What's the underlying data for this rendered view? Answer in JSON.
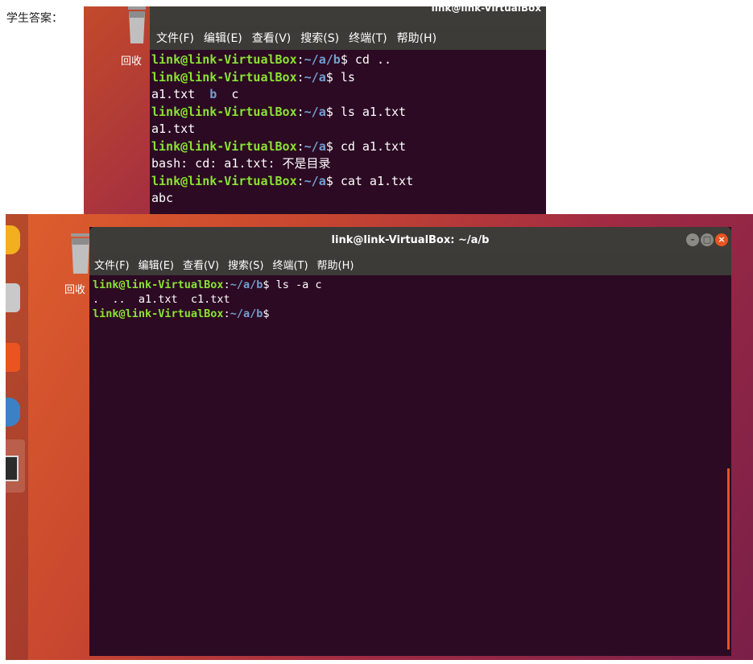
{
  "student_answer_label": "学生答案：",
  "shot1": {
    "title": "link@link-VirtualBox",
    "trash_caption": "回收",
    "menu": [
      "文件(F)",
      "编辑(E)",
      "查看(V)",
      "搜索(S)",
      "终端(T)",
      "帮助(H)"
    ],
    "lines": [
      {
        "user": "link@link-VirtualBox",
        "path": "~/a/b",
        "cmd": "cd .."
      },
      {
        "user": "link@link-VirtualBox",
        "path": "~/a",
        "cmd": "ls"
      },
      {
        "out_parts": [
          "a1.txt  ",
          "b",
          "  c"
        ]
      },
      {
        "user": "link@link-VirtualBox",
        "path": "~/a",
        "cmd": "ls a1.txt"
      },
      {
        "out": "a1.txt"
      },
      {
        "user": "link@link-VirtualBox",
        "path": "~/a",
        "cmd": "cd a1.txt"
      },
      {
        "out": "bash: cd: a1.txt: 不是目录"
      },
      {
        "user": "link@link-VirtualBox",
        "path": "~/a",
        "cmd": "cat a1.txt"
      },
      {
        "out": "abc"
      }
    ]
  },
  "shot2": {
    "title": "link@link-VirtualBox: ~/a/b",
    "trash_caption": "回收",
    "menu": [
      "文件(F)",
      "编辑(E)",
      "查看(V)",
      "搜索(S)",
      "终端(T)",
      "帮助(H)"
    ],
    "lines": [
      {
        "user": "link@link-VirtualBox",
        "path": "~/a/b",
        "cmd": "ls -a c"
      },
      {
        "out": ".  ..  a1.txt  c1.txt"
      },
      {
        "user": "link@link-VirtualBox",
        "path": "~/a/b",
        "cmd": ""
      }
    ],
    "window_buttons": [
      "minimize-icon",
      "maximize-icon",
      "close-icon"
    ]
  },
  "colors": {
    "terminal_bg": "#2c0a23",
    "prompt_user": "#8ae234",
    "prompt_path": "#729fcf",
    "close_button": "#e95420",
    "other_buttons": "#8b8a85"
  }
}
